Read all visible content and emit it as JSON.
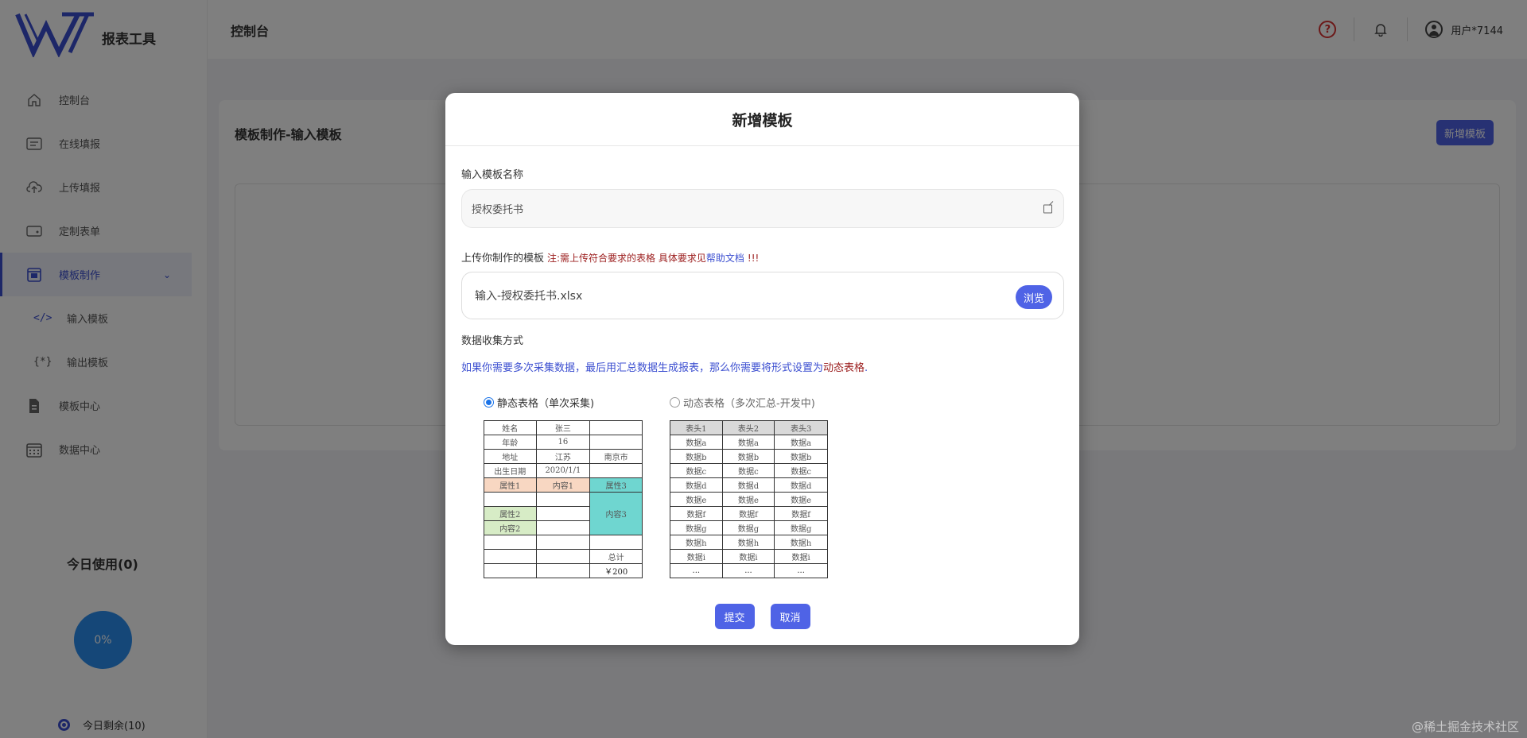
{
  "app": {
    "name": "报表工具"
  },
  "sidebar": {
    "items": [
      {
        "label": "控制台",
        "icon": "home-icon"
      },
      {
        "label": "在线填报",
        "icon": "list-icon"
      },
      {
        "label": "上传填报",
        "icon": "upload-cloud-icon"
      },
      {
        "label": "定制表单",
        "icon": "wallet-icon"
      },
      {
        "label": "模板制作",
        "icon": "archive-icon",
        "active": true
      },
      {
        "label": "输入模板",
        "icon": "code-icon"
      },
      {
        "label": "输出模板",
        "icon": "braces-icon"
      },
      {
        "label": "模板中心",
        "icon": "file-icon"
      },
      {
        "label": "数据中心",
        "icon": "calendar-icon"
      }
    ],
    "usage_title": "今日使用(0)",
    "usage_percent": "0%",
    "remaining": "今日剩余(10)"
  },
  "header": {
    "title": "控制台",
    "user": "用户*7144"
  },
  "main": {
    "card_title": "模板制作-输入模板",
    "add_button": "新增模板"
  },
  "modal": {
    "title": "新增模板",
    "name_label": "输入模板名称",
    "name_value": "授权委托书",
    "upload_label": "上传你制作的模板",
    "upload_note": "注:需上传符合要求的表格 具体要求见",
    "help_link": "帮助文档",
    "exclaim": "!!!",
    "file_name": "输入-授权委托书.xlsx",
    "browse_button": "浏览",
    "collect_label": "数据收集方式",
    "desc_prefix": "如果你需要多次采集数据，最后用汇总数据生成报表，那么你需要将形式设置为",
    "desc_highlight": "动态表格",
    "desc_suffix": ".",
    "option_static": "静态表格（单次采集)",
    "option_dynamic": "动态表格（多次汇总-开发中)",
    "static_table": {
      "r1": [
        "姓名",
        "张三",
        ""
      ],
      "r2": [
        "年龄",
        "16",
        ""
      ],
      "r3": [
        "地址",
        "江苏",
        "南京市"
      ],
      "r4": [
        "出生日期",
        "2020/1/1",
        ""
      ],
      "r5": [
        "属性1",
        "内容1",
        "属性3"
      ],
      "attr2": "属性2",
      "content2": "内容2",
      "content3": "内容3",
      "total": "总计",
      "amount": "￥200"
    },
    "dynamic_table": {
      "headers": [
        "表头1",
        "表头2",
        "表头3"
      ],
      "rows": [
        "数据a",
        "数据b",
        "数据c",
        "数据d",
        "数据e",
        "数据f",
        "数据g",
        "数据h",
        "数据i"
      ],
      "ellipsis": "..."
    },
    "submit_button": "提交",
    "cancel_button": "取消"
  },
  "watermark": "@稀土掘金技术社区"
}
